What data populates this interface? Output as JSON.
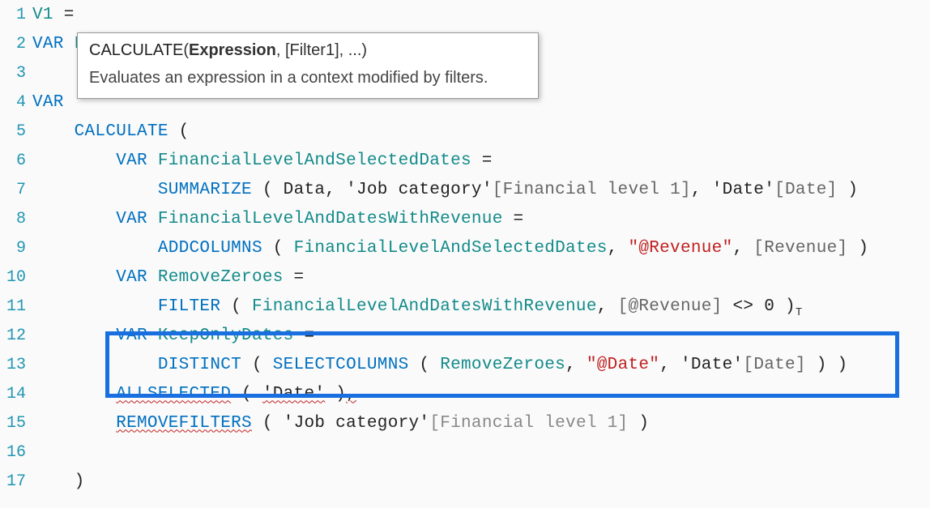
{
  "tooltip": {
    "func": "CALCULATE",
    "param_bold": "Expression",
    "rest": ", [Filter1], ...)",
    "desc": "Evaluates an expression in a context modified by filters."
  },
  "lines": {
    "l1_num": "1",
    "l1_v1": "V1",
    "l1_eq": " =",
    "l2_num": "2",
    "l2_var": "VAR ",
    "l2_name": "FinancialLevelInFilterContext",
    "l2_eq": " =",
    "l3_num": "3",
    "l4_num": "4",
    "l4_var": "VAR ",
    "l5_num": "5",
    "l5_calc": "CALCULATE",
    "l5_open": " (",
    "l6_num": "6",
    "l6_var": "VAR ",
    "l6_name": "FinancialLevelAndSelectedDates",
    "l6_eq": " =",
    "l7_num": "7",
    "l7_func": "SUMMARIZE",
    "l7_open": " ( ",
    "l7_data": "Data",
    "l7_c1": ", ",
    "l7_t1": "'Job category'",
    "l7_col1": "[Financial level 1]",
    "l7_c2": ", ",
    "l7_t2": "'Date'",
    "l7_col2": "[Date]",
    "l7_close": " )",
    "l8_num": "8",
    "l8_var": "VAR ",
    "l8_name": "FinancialLevelAndDatesWithRevenue",
    "l8_eq": " =",
    "l9_num": "9",
    "l9_func": "ADDCOLUMNS",
    "l9_open": " ( ",
    "l9_arg1": "FinancialLevelAndSelectedDates",
    "l9_c1": ", ",
    "l9_str": "\"@Revenue\"",
    "l9_c2": ", ",
    "l9_col": "[Revenue]",
    "l9_close": " )",
    "l10_num": "10",
    "l10_var": "VAR ",
    "l10_name": "RemoveZeroes",
    "l10_eq": " =",
    "l11_num": "11",
    "l11_func": "FILTER",
    "l11_open": " ( ",
    "l11_arg1": "FinancialLevelAndDatesWithRevenue",
    "l11_c1": ", ",
    "l11_col": "[@Revenue]",
    "l11_op": " <> ",
    "l11_zero": "0",
    "l11_close": " )",
    "l12_num": "12",
    "l12_var": "VAR ",
    "l12_name": "KeepOnlyDates",
    "l12_eq": " =",
    "l13_num": "13",
    "l13_func1": "DISTINCT",
    "l13_open1": " ( ",
    "l13_func2": "SELECTCOLUMNS",
    "l13_open2": " ( ",
    "l13_arg1": "RemoveZeroes",
    "l13_c1": ", ",
    "l13_str": "\"@Date\"",
    "l13_c2": ", ",
    "l13_t": "'Date'",
    "l13_col": "[Date]",
    "l13_close": " ) )",
    "l14_num": "14",
    "l14_func": "ALLSELECTED",
    "l14_open": " ( ",
    "l14_arg": "'Date'",
    "l14_close": " )",
    "l14_comma": ",",
    "l15_num": "15",
    "l15_func": "REMOVEFILTERS",
    "l15_open": " ( ",
    "l15_arg": "'Job category'",
    "l15_col": "[Financial level 1]",
    "l15_close": " )",
    "l16_num": "16",
    "l17_num": "17",
    "l17_close": ")"
  }
}
